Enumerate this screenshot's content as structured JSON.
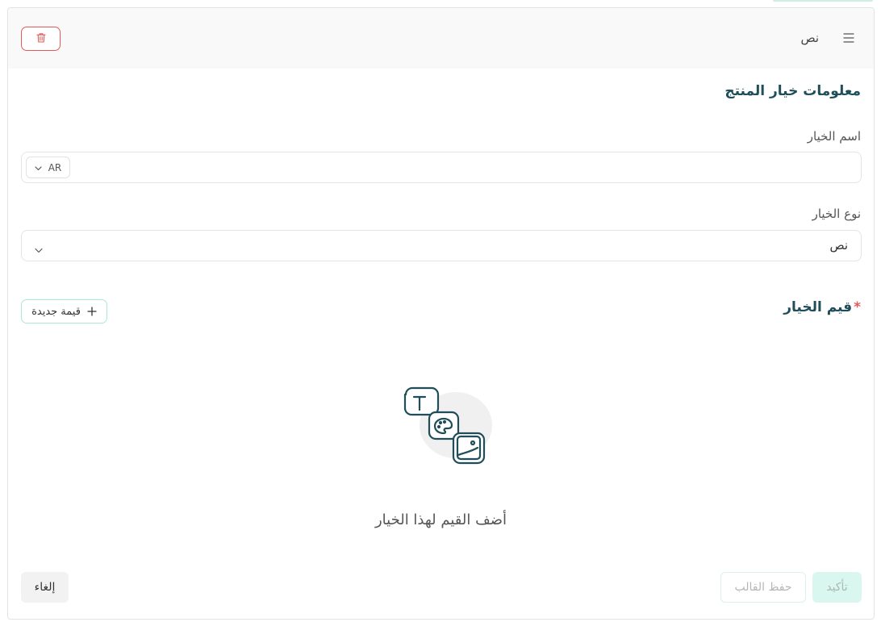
{
  "header": {
    "title": "نص",
    "drag_icon": "drag-handle-icon",
    "delete_icon": "trash-icon"
  },
  "section": {
    "title": "معلومات خيار المنتج"
  },
  "option_name": {
    "label": "اسم الخيار",
    "value": "",
    "language": "AR"
  },
  "option_type": {
    "label": "نوع الخيار",
    "value": "نص"
  },
  "option_values": {
    "title": "قيم الخيار",
    "required_mark": "*",
    "new_value_label": "قيمة جديدة",
    "empty_message": "أضف القيم لهذا الخيار"
  },
  "footer": {
    "cancel_label": "إلغاء",
    "save_template_label": "حفظ القالب",
    "confirm_label": "تأكيد"
  },
  "colors": {
    "accent": "#1f4e5a",
    "danger": "#e25b5b",
    "mint_border": "#a9e8d8",
    "confirm_bg": "#daf7ef"
  }
}
